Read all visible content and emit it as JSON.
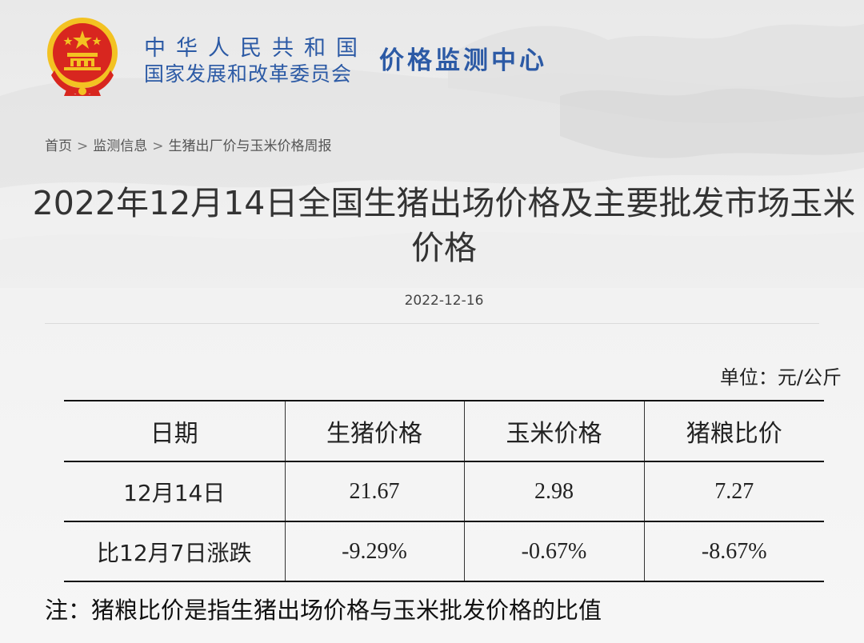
{
  "header": {
    "org_name_cn": "中华人民共和国",
    "ndrc": "国家发展和改革委员会",
    "center": "价格监测中心",
    "colors": {
      "brand_blue": "#2c5aa5",
      "emblem_red": "#d8261f",
      "emblem_gold": "#f3c222"
    }
  },
  "breadcrumb": {
    "home": "首页",
    "sep": ">",
    "level2": "监测信息",
    "level3": "生猪出厂价与玉米价格周报"
  },
  "article": {
    "title": "2022年12月14日全国生猪出场价格及主要批发市场玉米价格",
    "date": "2022-12-16",
    "unit": "单位：元/公斤",
    "note": "注：猪粮比价是指生猪出场价格与玉米批发价格的比值"
  },
  "table": {
    "headers": [
      "日期",
      "生猪价格",
      "玉米价格",
      "猪粮比价"
    ],
    "rows": [
      [
        "12月14日",
        "21.67",
        "2.98",
        "7.27"
      ],
      [
        "比12月7日涨跌",
        "-9.29%",
        "-0.67%",
        "-8.67%"
      ]
    ]
  }
}
